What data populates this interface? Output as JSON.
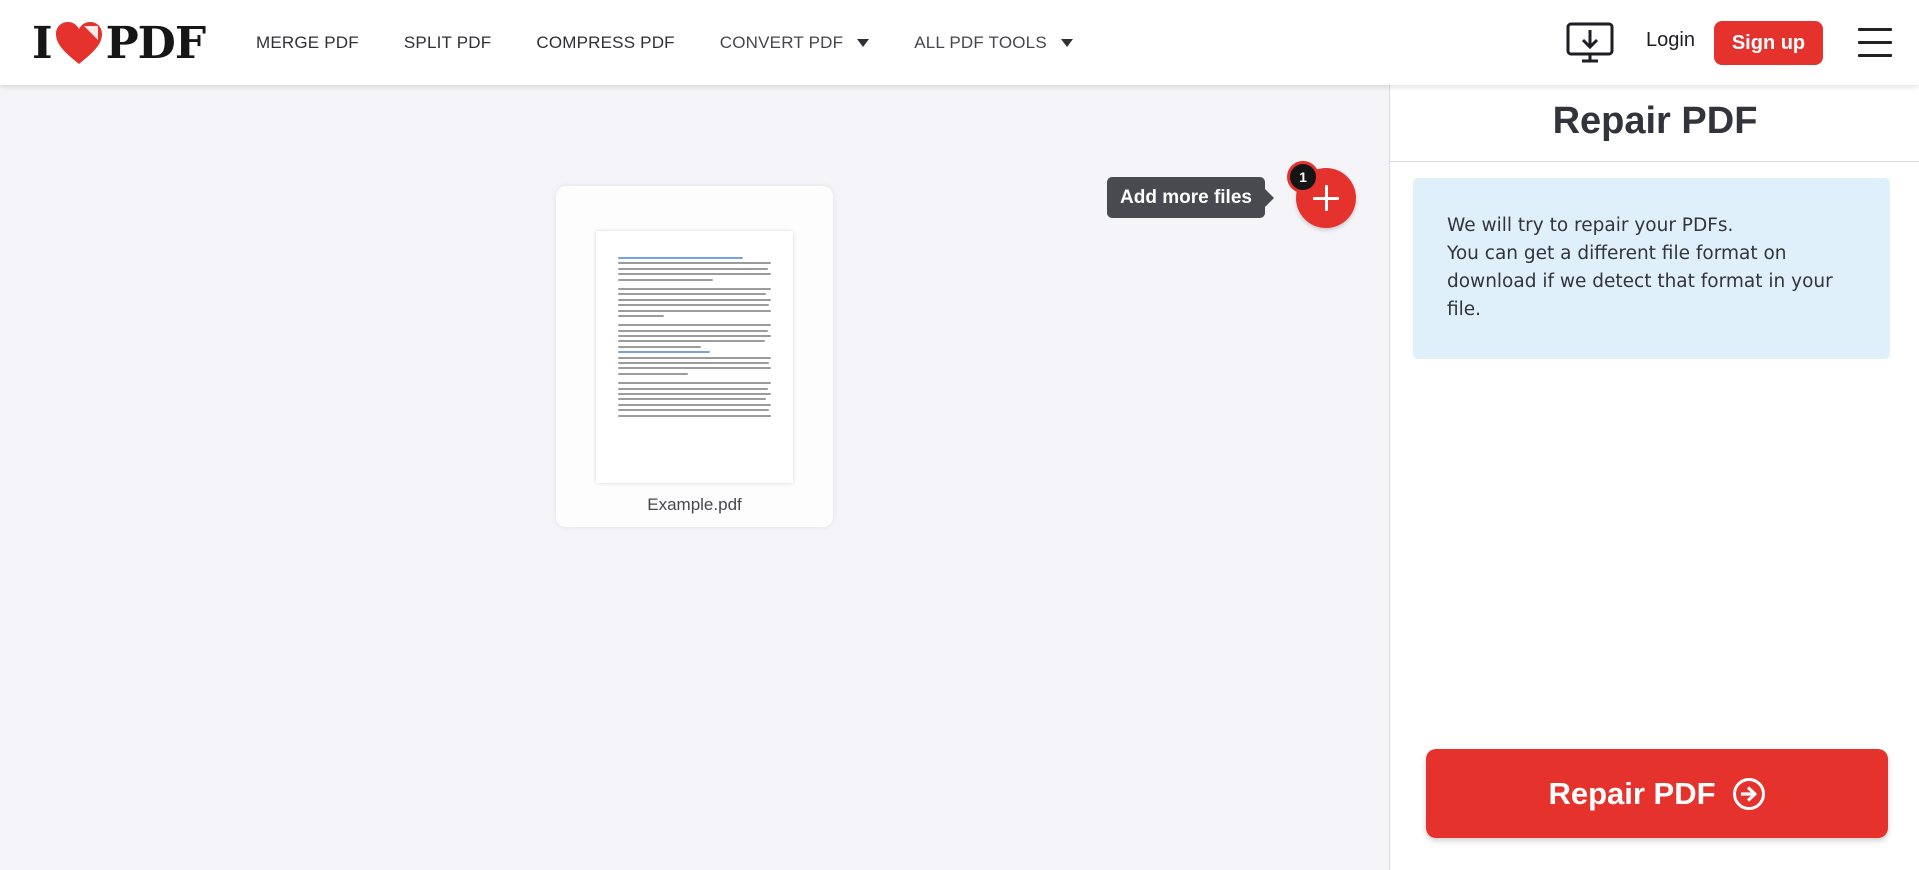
{
  "header": {
    "logo_left": "I",
    "logo_right": "PDF",
    "nav": [
      {
        "label": "MERGE PDF"
      },
      {
        "label": "SPLIT PDF"
      },
      {
        "label": "COMPRESS PDF"
      },
      {
        "label": "CONVERT PDF"
      },
      {
        "label": "ALL PDF TOOLS"
      }
    ],
    "login_label": "Login",
    "signup_label": "Sign up"
  },
  "workspace": {
    "file": {
      "name": "Example.pdf"
    },
    "add_files_label": "Add more files",
    "file_count": "1"
  },
  "sidebar": {
    "title": "Repair PDF",
    "info_line1": "We will try to repair your PDFs.",
    "info_line2": "You can get a different file format on download if we detect that format in your file.",
    "action_label": "Repair PDF"
  },
  "colors": {
    "brand_red": "#e5322d",
    "info_bg": "#dff0fb",
    "workspace_bg": "#f4f4f9"
  },
  "icons": {
    "desktop": "desktop-download-icon",
    "menu": "hamburger-menu-icon",
    "add": "plus-icon",
    "action": "arrow-right-circle-icon"
  }
}
